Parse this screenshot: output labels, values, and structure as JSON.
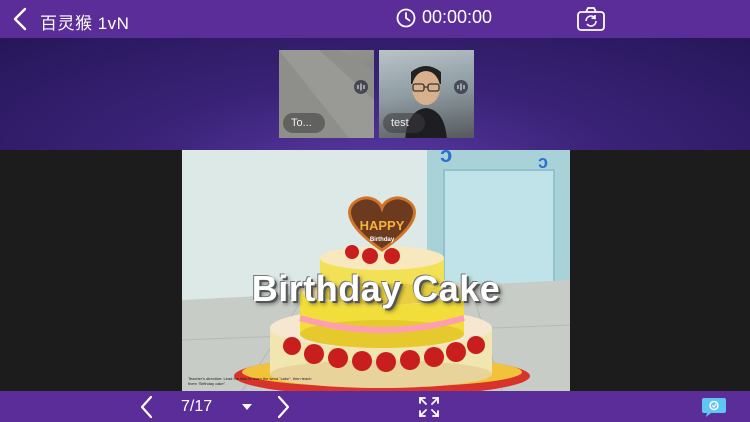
{
  "header": {
    "title": "百灵猴 1vN",
    "timer": "00:00:00"
  },
  "videos": [
    {
      "label": "To..."
    },
    {
      "label": "test"
    }
  ],
  "slide": {
    "title": "Birthday Cake",
    "topper_text": "HAPPY",
    "topper_subtext": "Birthday",
    "note": "Teacher's direction: Lead the kids to learn the word \"cake\", then teach them \"Birthday cake\"."
  },
  "pager": {
    "page_label": "7/17"
  },
  "colors": {
    "bar": "#5a2d98",
    "strip": "#3a2378"
  }
}
